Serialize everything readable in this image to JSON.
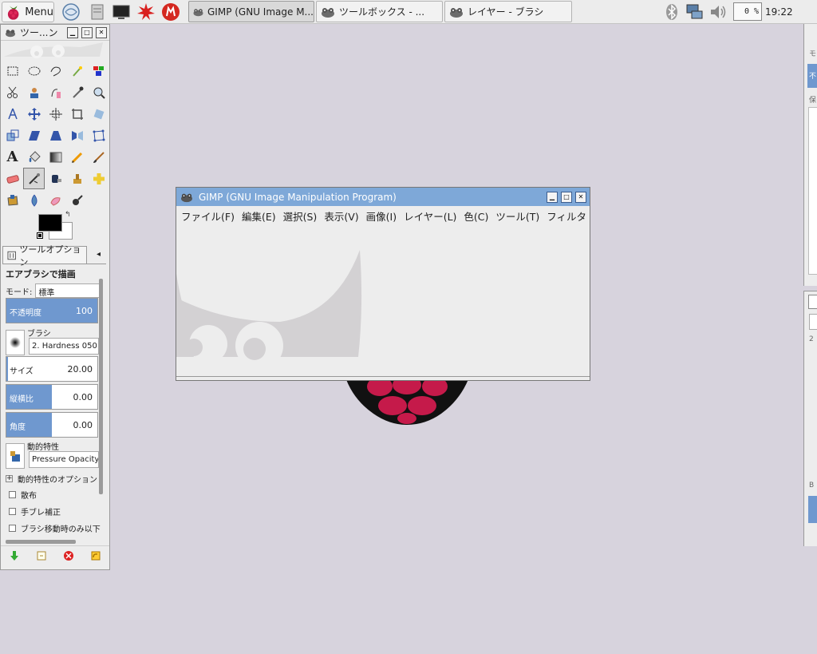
{
  "taskbar": {
    "menu_label": "Menu",
    "tasks": [
      {
        "label": "GIMP (GNU Image M..."
      },
      {
        "label": "ツールボックス - ..."
      },
      {
        "label": "レイヤー - ブラシ"
      }
    ],
    "cpu": "0 %",
    "clock": "19:22"
  },
  "toolbox": {
    "title": "ツー...ン",
    "tools": [
      "rect-select",
      "ellipse-select",
      "free-select",
      "fuzzy-select",
      "select-by-color",
      "scissors",
      "foreground-select",
      "paths",
      "color-picker",
      "zoom",
      "measure",
      "move",
      "align",
      "crop",
      "rotate",
      "scale",
      "shear",
      "perspective",
      "flip",
      "cage",
      "text",
      "bucket-fill",
      "blend",
      "pencil",
      "paintbrush",
      "eraser",
      "airbrush",
      "ink",
      "clone",
      "heal",
      "perspective-clone",
      "blur",
      "smudge",
      "dodge-burn"
    ],
    "tab_label": "ツールオプション",
    "options_heading": "エアブラシで描画",
    "mode_label": "モード:",
    "mode_value": "標準",
    "opacity_label": "不透明度",
    "opacity_value": "100",
    "brush_label": "ブラシ",
    "brush_value": "2. Hardness 050",
    "size_label": "サイズ",
    "size_value": "20.00",
    "aspect_label": "縦横比",
    "aspect_value": "0.00",
    "angle_label": "角度",
    "angle_value": "0.00",
    "dynamics_label": "動的特性",
    "dynamics_value": "Pressure Opacity",
    "dynamics_options": "動的特性のオプション",
    "scatter": "散布",
    "stabilize": "手ブレ補正",
    "incremental": "ブラシ移動時のみ以下"
  },
  "gimp": {
    "title": "GIMP (GNU Image Manipulation Program)",
    "menu": [
      "ファイル(F)",
      "編集(E)",
      "選択(S)",
      "表示(V)",
      "画像(I)",
      "レイヤー(L)",
      "色(C)",
      "ツール(T)",
      "フィルタ"
    ]
  },
  "right_dock": {
    "frag1": "モ",
    "frag2": "不",
    "frag3": "保",
    "frag4": "2",
    "frag5": "B"
  }
}
